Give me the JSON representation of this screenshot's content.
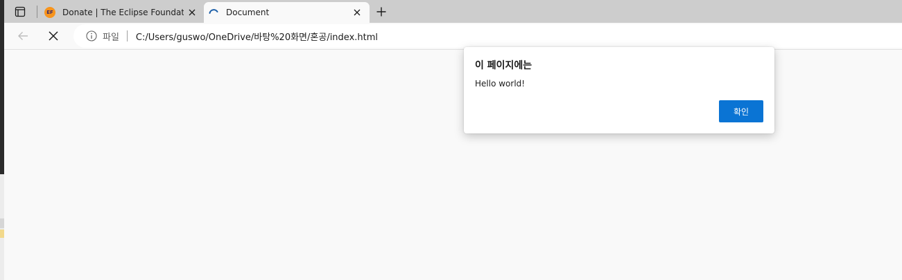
{
  "tabs": [
    {
      "title": "Donate | The Eclipse Foundation",
      "favicon": "EF",
      "state": "inactive"
    },
    {
      "title": "Document",
      "state": "active-loading"
    }
  ],
  "address_bar": {
    "scheme_label": "파일",
    "url": "C:/Users/guswo/OneDrive/바탕%20화면/혼공/index.html"
  },
  "dialog": {
    "title": "이 페이지에는",
    "message": "Hello world!",
    "ok_label": "확인"
  },
  "colors": {
    "accent": "#0a74d4",
    "tabbar": "#cdcdcd",
    "page_bg": "#f9f9f9"
  }
}
